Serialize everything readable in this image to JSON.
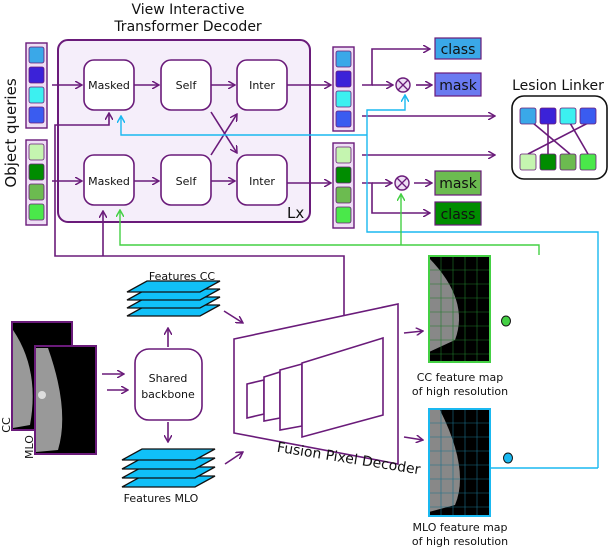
{
  "title_line1": "View Interactive",
  "title_line2": "Transformer Decoder",
  "object_queries_label": "Object queries",
  "blocks": {
    "masked": "Masked",
    "self": "Self",
    "inter": "Inter"
  },
  "repeat_label": "Lx",
  "outputs": {
    "class": "class",
    "mask": "mask"
  },
  "lesion_linker_label": "Lesion Linker",
  "backbone_line1": "Shared",
  "backbone_line2": "backbone",
  "features_cc": "Features CC",
  "features_mlo": "Features MLO",
  "pixel_decoder_label": "Fusion Pixel Decoder",
  "view_cc": "CC",
  "view_mlo": "MLO",
  "cc_map_line1": "CC feature map",
  "cc_map_line2": "of high resolution",
  "mlo_map_line1": "MLO feature map",
  "mlo_map_line2": "of high resolution",
  "colors": {
    "accent": "#6a1b7a",
    "cc_query": [
      "#3aa8e8",
      "#3b22d8",
      "#3cf0f0",
      "#3a5cf0"
    ],
    "mlo_query": [
      "#c5f5b0",
      "#008c00",
      "#6cbb50",
      "#4ae84a"
    ],
    "cyan_path": "#1ab8f0",
    "green_path": "#44d044",
    "feature_maps": "#10c0f8"
  }
}
